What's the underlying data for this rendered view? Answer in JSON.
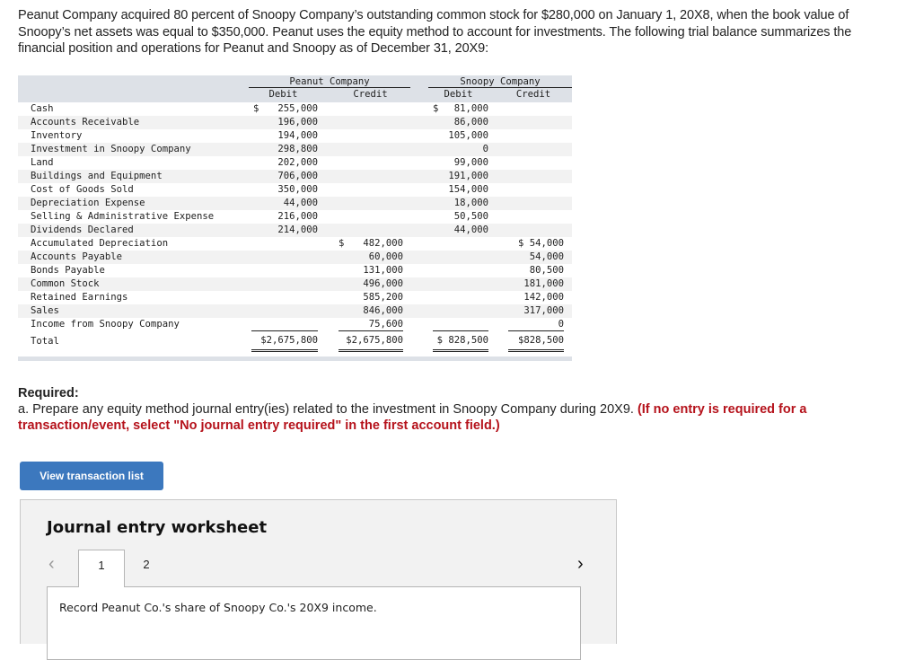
{
  "intro": "Peanut Company acquired 80 percent of Snoopy Company’s outstanding common stock for $280,000 on January 1, 20X8, when the book value of Snoopy’s net assets was equal to $350,000. Peanut uses the equity method to account for investments. The following trial balance summarizes the financial position and operations for Peanut and Snoopy as of December 31, 20X9:",
  "trial_balance": {
    "groups": [
      "Peanut Company",
      "Snoopy Company"
    ],
    "subheaders": [
      "Debit",
      "Credit",
      "Debit",
      "Credit"
    ],
    "rows": [
      {
        "account": "Cash",
        "p_debit": "255,000",
        "p_debit_dollar": "$",
        "p_credit": "",
        "s_debit": "81,000",
        "s_debit_dollar": "$",
        "s_credit": ""
      },
      {
        "account": "Accounts Receivable",
        "p_debit": "196,000",
        "p_credit": "",
        "s_debit": "86,000",
        "s_credit": ""
      },
      {
        "account": "Inventory",
        "p_debit": "194,000",
        "p_credit": "",
        "s_debit": "105,000",
        "s_credit": ""
      },
      {
        "account": "Investment in Snoopy Company",
        "p_debit": "298,800",
        "p_credit": "",
        "s_debit": "0",
        "s_credit": ""
      },
      {
        "account": "Land",
        "p_debit": "202,000",
        "p_credit": "",
        "s_debit": "99,000",
        "s_credit": ""
      },
      {
        "account": "Buildings and Equipment",
        "p_debit": "706,000",
        "p_credit": "",
        "s_debit": "191,000",
        "s_credit": ""
      },
      {
        "account": "Cost of Goods Sold",
        "p_debit": "350,000",
        "p_credit": "",
        "s_debit": "154,000",
        "s_credit": ""
      },
      {
        "account": "Depreciation Expense",
        "p_debit": "44,000",
        "p_credit": "",
        "s_debit": "18,000",
        "s_credit": ""
      },
      {
        "account": "Selling & Administrative Expense",
        "p_debit": "216,000",
        "p_credit": "",
        "s_debit": "50,500",
        "s_credit": ""
      },
      {
        "account": "Dividends Declared",
        "p_debit": "214,000",
        "p_credit": "",
        "s_debit": "44,000",
        "s_credit": ""
      },
      {
        "account": "Accumulated Depreciation",
        "p_debit": "",
        "p_credit": "482,000",
        "p_credit_dollar": "$",
        "s_debit": "",
        "s_credit": "$ 54,000"
      },
      {
        "account": "Accounts Payable",
        "p_debit": "",
        "p_credit": "60,000",
        "s_debit": "",
        "s_credit": "54,000"
      },
      {
        "account": "Bonds Payable",
        "p_debit": "",
        "p_credit": "131,000",
        "s_debit": "",
        "s_credit": "80,500"
      },
      {
        "account": "Common Stock",
        "p_debit": "",
        "p_credit": "496,000",
        "s_debit": "",
        "s_credit": "181,000"
      },
      {
        "account": "Retained Earnings",
        "p_debit": "",
        "p_credit": "585,200",
        "s_debit": "",
        "s_credit": "142,000"
      },
      {
        "account": "Sales",
        "p_debit": "",
        "p_credit": "846,000",
        "s_debit": "",
        "s_credit": "317,000"
      },
      {
        "account": "Income from Snoopy Company",
        "p_debit": "",
        "p_credit": "75,600",
        "s_debit": "",
        "s_credit": "0"
      }
    ],
    "total": {
      "account": "Total",
      "p_debit": "$2,675,800",
      "p_credit": "$2,675,800",
      "s_debit": "$ 828,500",
      "s_credit": "$828,500"
    }
  },
  "required": {
    "label": "Required:",
    "text": "a. Prepare any equity method journal entry(ies) related to the investment in Snoopy Company during 20X9.",
    "note": "(If no entry is required for a transaction/event, select \"No journal entry required\" in the first account field.)"
  },
  "view_button": "View transaction list",
  "worksheet": {
    "title": "Journal entry worksheet",
    "prev_icon": "‹",
    "next_icon": "›",
    "tabs": [
      "1",
      "2"
    ],
    "active_tab": "1",
    "description": "Record Peanut Co.'s share of Snoopy Co.'s 20X9 income."
  },
  "colors": {
    "accent_button": "#3c78be",
    "note_red": "#b5121b",
    "table_header_bg": "#dde1e7"
  }
}
